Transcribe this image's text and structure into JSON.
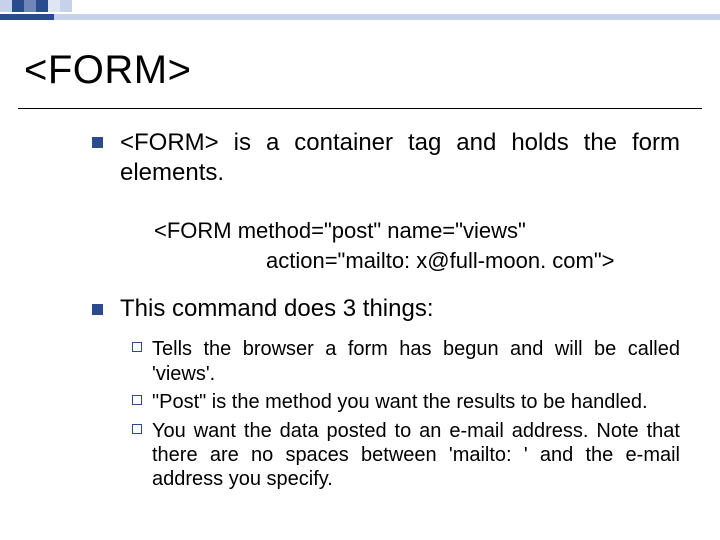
{
  "title": "<FORM>",
  "bullets": {
    "intro": "<FORM> is a container tag and holds the form elements.",
    "codeLine1": "<FORM  method=\"post\"   name=\"views\"",
    "codeLine2": "action=\"mailto: x@full-moon. com\">",
    "second": "This command does 3 things:",
    "sub": [
      "Tells the browser a form has begun and will be called 'views'.",
      "\"Post\" is the method you want the results to be handled.",
      "You want the data posted to an e-mail address. Note that there are no spaces between 'mailto: ' and the e-mail address you specify."
    ]
  }
}
